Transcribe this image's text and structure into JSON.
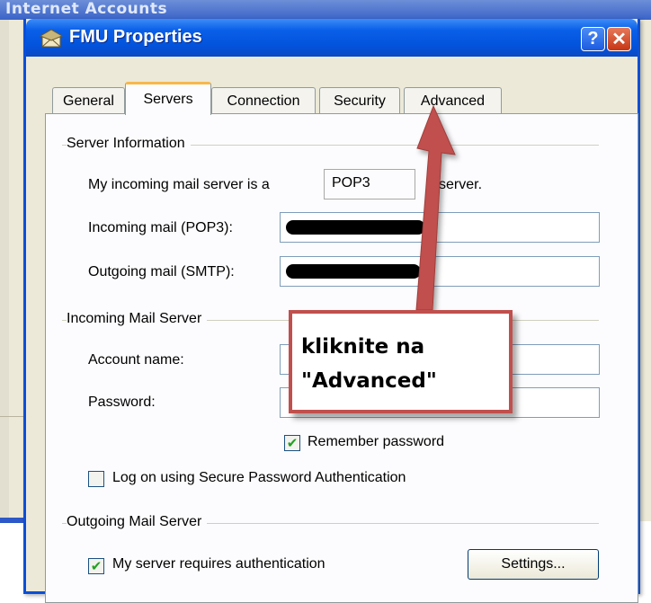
{
  "background_window": {
    "title": "Internet Accounts"
  },
  "dialog": {
    "title": "FMU Properties",
    "help_button": "?",
    "close_button": "✕"
  },
  "tabs": [
    {
      "label": "General",
      "active": false
    },
    {
      "label": "Servers",
      "active": true
    },
    {
      "label": "Connection",
      "active": false
    },
    {
      "label": "Security",
      "active": false
    },
    {
      "label": "Advanced",
      "active": false
    }
  ],
  "server_info": {
    "heading": "Server Information",
    "incoming_type_prefix": "My incoming mail server is a",
    "incoming_type_value": "POP3",
    "incoming_type_suffix": "server.",
    "incoming_label": "Incoming mail (POP3):",
    "outgoing_label": "Outgoing mail (SMTP):"
  },
  "incoming_server": {
    "heading": "Incoming Mail Server",
    "account_label": "Account name:",
    "password_label": "Password:",
    "remember_label": "Remember password",
    "remember_checked": true,
    "spa_label": "Log on using Secure Password Authentication",
    "spa_checked": false
  },
  "outgoing_server": {
    "heading": "Outgoing Mail Server",
    "auth_label": "My server requires authentication",
    "auth_checked": true,
    "settings_button": "Settings..."
  },
  "annotation": {
    "line1": "kliknite na",
    "line2": "\"Advanced\"",
    "color": "#c0504d"
  },
  "colors": {
    "titlebar": "#0353dc",
    "dialog_face": "#ece9d8",
    "active_tab_accent": "#f7b74c",
    "check_green": "#21a121"
  }
}
